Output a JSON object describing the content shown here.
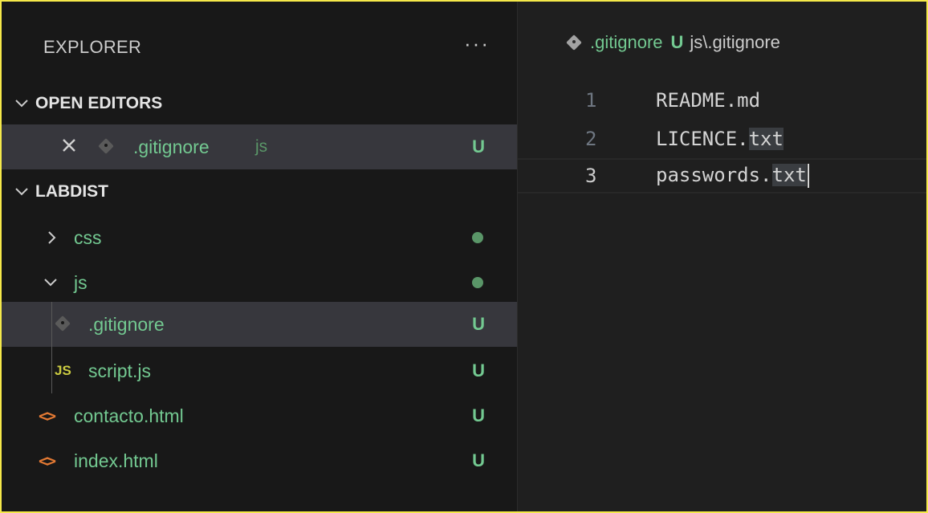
{
  "explorer": {
    "title": "EXPLORER",
    "more_label": "···"
  },
  "open_editors": {
    "header": "OPEN EDITORS",
    "items": [
      {
        "name": ".gitignore",
        "folder": "js",
        "status": "U"
      }
    ]
  },
  "workspace": {
    "header": "LABDIST",
    "tree": [
      {
        "name": "css",
        "type": "folder",
        "expanded": false
      },
      {
        "name": "js",
        "type": "folder",
        "expanded": true
      },
      {
        "name": ".gitignore",
        "type": "file",
        "status": "U",
        "icon": "git-icon"
      },
      {
        "name": "script.js",
        "type": "file",
        "status": "U",
        "icon": "js-icon",
        "icon_text": "JS"
      },
      {
        "name": "contacto.html",
        "type": "file",
        "status": "U",
        "icon": "html-icon",
        "icon_text": "<>"
      },
      {
        "name": "index.html",
        "type": "file",
        "status": "U",
        "icon": "html-icon",
        "icon_text": "<>"
      }
    ]
  },
  "editor": {
    "breadcrumb": {
      "file": ".gitignore",
      "badge": "U",
      "path": "js\\.gitignore"
    },
    "lines": [
      {
        "number": "1",
        "before": "README.md",
        "highlight": ""
      },
      {
        "number": "2",
        "before": "LICENCE.",
        "highlight": "txt"
      },
      {
        "number": "3",
        "before": "passwords.",
        "highlight": "txt"
      }
    ]
  },
  "colors": {
    "untracked_green": "#73c991",
    "html_orange": "#e37933",
    "js_yellow": "#cbcb41",
    "border_yellow": "#f5e94a"
  }
}
